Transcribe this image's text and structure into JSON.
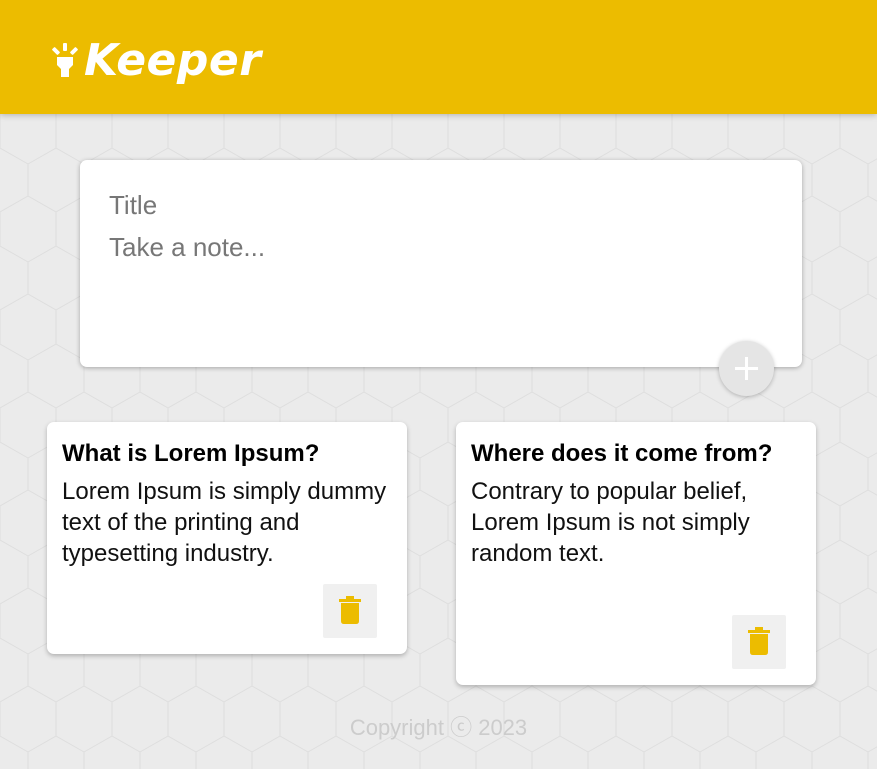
{
  "app": {
    "name": "Keeper",
    "logo_icon": "lightbulb-icon",
    "brand_color": "#ecbc00",
    "background_color": "#ebebeb"
  },
  "create_area": {
    "title_placeholder": "Title",
    "content_placeholder": "Take a note...",
    "add_icon": "plus-icon"
  },
  "notes": [
    {
      "title": "What is Lorem Ipsum?",
      "content": "Lorem Ipsum is simply dummy text of the printing and typesetting industry.",
      "delete_icon": "trash-icon"
    },
    {
      "title": "Where does it come from?",
      "content": "Contrary to popular belief, Lorem Ipsum is not simply random text.",
      "delete_icon": "trash-icon"
    }
  ],
  "footer": {
    "copyright": "Copyright ⓒ 2023"
  }
}
